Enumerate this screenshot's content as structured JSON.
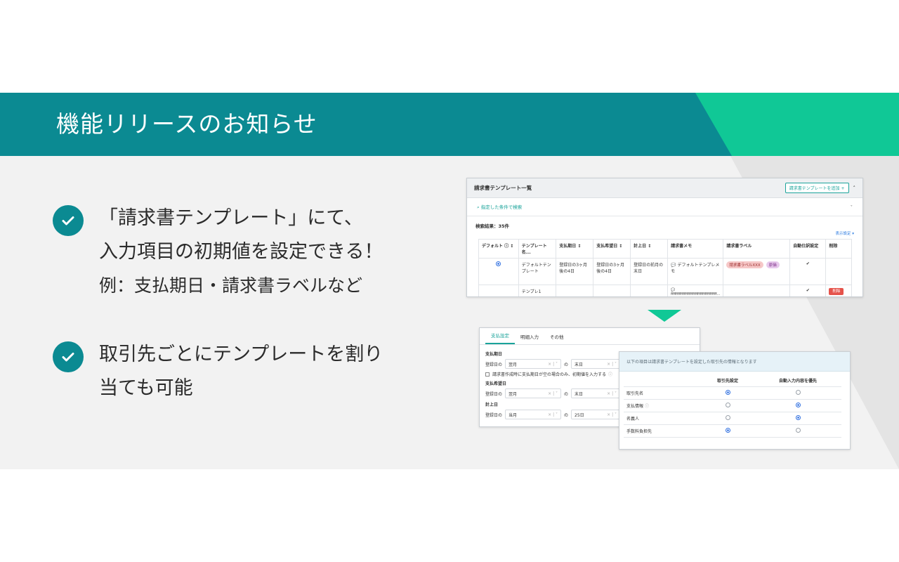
{
  "banner": {
    "title": "機能リリースのお知らせ"
  },
  "bullets": [
    {
      "line1": "「請求書テンプレート」にて、",
      "line2": "入力項目の初期値を設定できる！",
      "line3": "例：支払期日・請求書ラベルなど"
    },
    {
      "line1": "取引先ごとにテンプレートを割り",
      "line2": "当ても可能"
    }
  ],
  "template_list": {
    "title": "請求書テンプレート一覧",
    "add_button": "請求書テンプレートを追加",
    "search_link": "指定した条件で検索",
    "result_count": "検索結果：35件",
    "display_settings": "表示設定",
    "columns": [
      "デフォルト",
      "テンプレート名",
      "支払期日",
      "支払希望日",
      "計上日",
      "請求書メモ",
      "請求書ラベル",
      "自動仕訳設定",
      "削除"
    ],
    "rows": [
      {
        "name": "デフォルトテンプレート",
        "due": "登録日の3ヶ月後の4日",
        "desired": "登録日の3ヶ月後の4日",
        "booked": "登録日の前月の末日",
        "memo": "デフォルトテンプレメモ",
        "labels": [
          "請求書ラベルXXX",
          "原価"
        ],
        "delete": ""
      },
      {
        "name": "テンプレ1",
        "due": "",
        "desired": "",
        "booked": "",
        "memo": "ffffffffffffffffffffffffffffffffffffff...",
        "labels": [],
        "delete": "削除"
      }
    ]
  },
  "settings_form": {
    "tabs": [
      "支払設定",
      "明細入力",
      "その他"
    ],
    "due_label": "支払期日",
    "prefix": "登録日の",
    "connector": "の",
    "due_month": "翌月",
    "due_day": "末日",
    "checkbox_text": "請求書作成時に支払期日が空の場合のみ、初期値を入力する",
    "desired_label": "支払希望日",
    "desired_month": "翌月",
    "desired_day": "末日",
    "booked_label": "計上日",
    "booked_month": "当月",
    "booked_day": "25日"
  },
  "partner_panel": {
    "header": "以下の項目は請求書テンプレートを設定した取引先の情報となります",
    "col_partner": "取引先設定",
    "col_auto": "自動入力内容を優先",
    "rows": [
      {
        "label": "取引先名",
        "partner": true
      },
      {
        "label": "支払情報",
        "partner": false
      },
      {
        "label": "名義人",
        "partner": false
      },
      {
        "label": "手数料負担先",
        "partner": true
      }
    ]
  },
  "colors": {
    "teal": "#0b8a92",
    "green": "#10c896"
  }
}
